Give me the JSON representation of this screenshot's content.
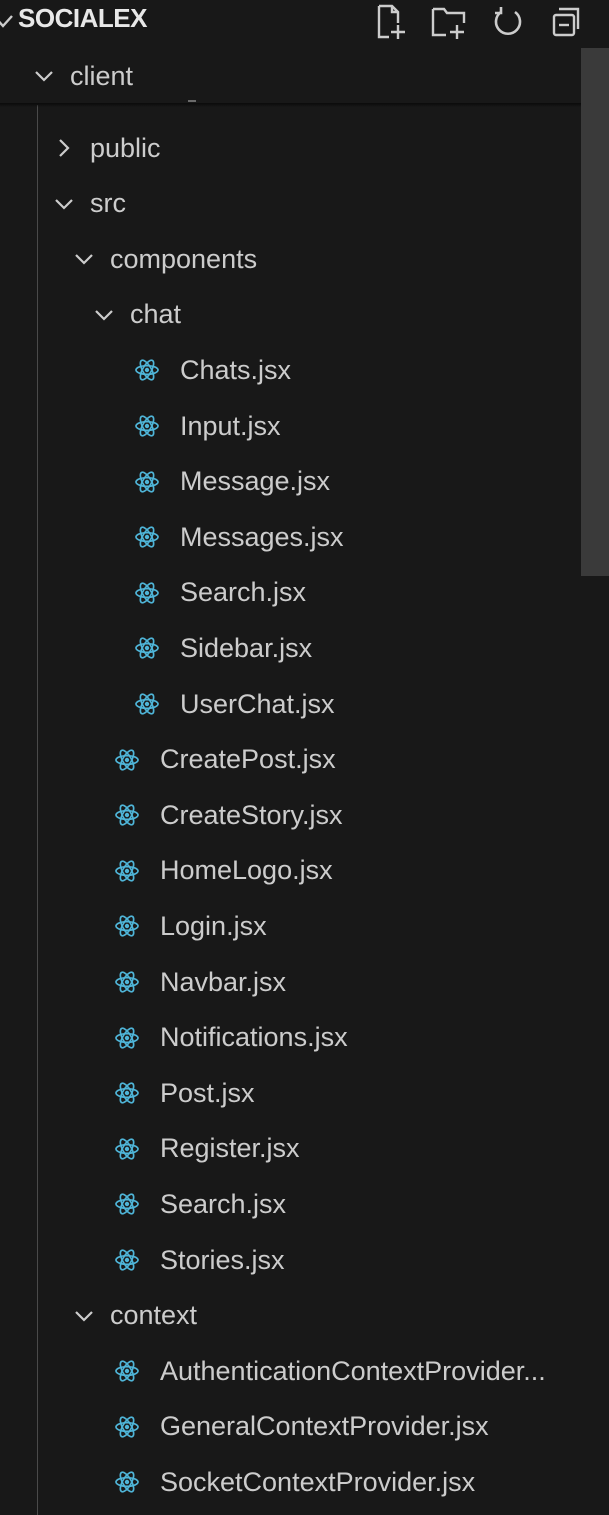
{
  "explorer": {
    "section_title": "SOCIALEX",
    "toolbar": {
      "new_file": "new-file-icon",
      "new_folder": "new-folder-icon",
      "refresh": "refresh-icon",
      "collapse_all": "collapse-all-icon"
    },
    "colors": {
      "background": "#181818",
      "text": "#cccccc",
      "react_icon": "#4fb5d8",
      "guide": "#4a4a4a",
      "scrollbar": "#3a3a3a"
    },
    "tree": [
      {
        "label": "client",
        "kind": "folder",
        "expanded": true,
        "depth": 0,
        "icon": "chevron-down-icon"
      },
      {
        "label": "public",
        "kind": "folder",
        "expanded": false,
        "depth": 1,
        "icon": "chevron-right-icon"
      },
      {
        "label": "src",
        "kind": "folder",
        "expanded": true,
        "depth": 1,
        "icon": "chevron-down-icon"
      },
      {
        "label": "components",
        "kind": "folder",
        "expanded": true,
        "depth": 2,
        "icon": "chevron-down-icon"
      },
      {
        "label": "chat",
        "kind": "folder",
        "expanded": true,
        "depth": 3,
        "icon": "chevron-down-icon"
      },
      {
        "label": "Chats.jsx",
        "kind": "file",
        "depth": 4,
        "icon": "react-icon"
      },
      {
        "label": "Input.jsx",
        "kind": "file",
        "depth": 4,
        "icon": "react-icon"
      },
      {
        "label": "Message.jsx",
        "kind": "file",
        "depth": 4,
        "icon": "react-icon"
      },
      {
        "label": "Messages.jsx",
        "kind": "file",
        "depth": 4,
        "icon": "react-icon"
      },
      {
        "label": "Search.jsx",
        "kind": "file",
        "depth": 4,
        "icon": "react-icon"
      },
      {
        "label": "Sidebar.jsx",
        "kind": "file",
        "depth": 4,
        "icon": "react-icon"
      },
      {
        "label": "UserChat.jsx",
        "kind": "file",
        "depth": 4,
        "icon": "react-icon"
      },
      {
        "label": "CreatePost.jsx",
        "kind": "file",
        "depth": 3,
        "icon": "react-icon"
      },
      {
        "label": "CreateStory.jsx",
        "kind": "file",
        "depth": 3,
        "icon": "react-icon"
      },
      {
        "label": "HomeLogo.jsx",
        "kind": "file",
        "depth": 3,
        "icon": "react-icon"
      },
      {
        "label": "Login.jsx",
        "kind": "file",
        "depth": 3,
        "icon": "react-icon"
      },
      {
        "label": "Navbar.jsx",
        "kind": "file",
        "depth": 3,
        "icon": "react-icon"
      },
      {
        "label": "Notifications.jsx",
        "kind": "file",
        "depth": 3,
        "icon": "react-icon"
      },
      {
        "label": "Post.jsx",
        "kind": "file",
        "depth": 3,
        "icon": "react-icon"
      },
      {
        "label": "Register.jsx",
        "kind": "file",
        "depth": 3,
        "icon": "react-icon"
      },
      {
        "label": "Search.jsx",
        "kind": "file",
        "depth": 3,
        "icon": "react-icon"
      },
      {
        "label": "Stories.jsx",
        "kind": "file",
        "depth": 3,
        "icon": "react-icon"
      },
      {
        "label": "context",
        "kind": "folder",
        "expanded": true,
        "depth": 2,
        "icon": "chevron-down-icon"
      },
      {
        "label": "AuthenticationContextProvider...",
        "kind": "file",
        "depth": 3,
        "icon": "react-icon"
      },
      {
        "label": "GeneralContextProvider.jsx",
        "kind": "file",
        "depth": 3,
        "icon": "react-icon"
      },
      {
        "label": "SocketContextProvider.jsx",
        "kind": "file",
        "depth": 3,
        "icon": "react-icon"
      }
    ]
  }
}
